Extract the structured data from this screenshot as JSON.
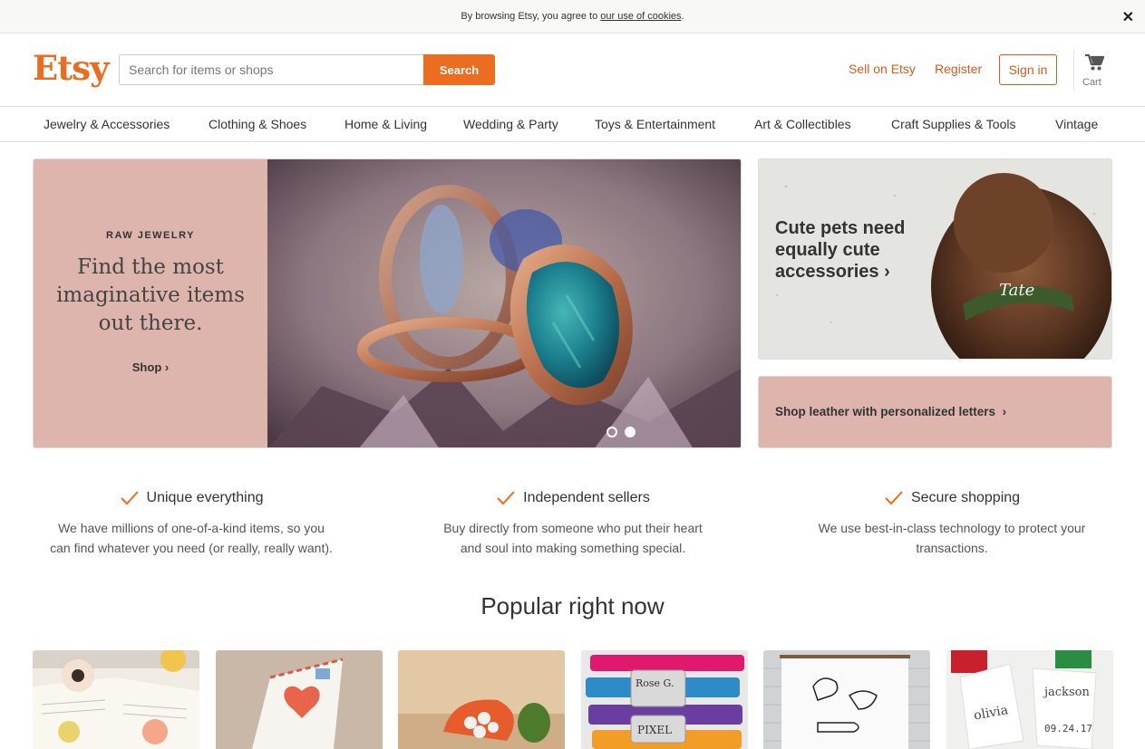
{
  "cookie_bar": {
    "text": "By browsing Etsy, you agree to ",
    "link": "our use of cookies",
    "suffix": "."
  },
  "header": {
    "logo": "Etsy",
    "search_placeholder": "Search for items or shops",
    "search_button": "Search",
    "sell": "Sell on Etsy",
    "register": "Register",
    "signin": "Sign in",
    "cart": "Cart"
  },
  "nav": {
    "items": [
      "Jewelry & Accessories",
      "Clothing & Shoes",
      "Home & Living",
      "Wedding & Party",
      "Toys & Entertainment",
      "Art & Collectibles",
      "Craft Supplies & Tools",
      "Vintage"
    ]
  },
  "hero": {
    "eyebrow": "RAW JEWELRY",
    "headline": "Find the most imaginative items out there.",
    "cta": "Shop",
    "colors": {
      "panel": "#deb5ad"
    }
  },
  "side": {
    "pets_text": "Cute pets need equally cute accessories",
    "collar_text": "Tate",
    "leather_text": "Shop leather with personalized letters"
  },
  "props": [
    {
      "title": "Unique everything",
      "desc": "We have millions of one-of-a-kind items, so you can find whatever you need (or really, really want)."
    },
    {
      "title": "Independent sellers",
      "desc": "Buy directly from someone who put their heart and soul into making something special."
    },
    {
      "title": "Secure shopping",
      "desc": "We use best-in-class technology to protect your transactions."
    }
  ],
  "popular": {
    "title": "Popular right now",
    "item_texts": {
      "collar_name": "Rose G.",
      "collar_brand": "PIXEL",
      "tag1_name": "olivia",
      "tag2_name": "jackson",
      "tag2_date": "09.24.17"
    }
  },
  "colors": {
    "brand": "#eb6d20",
    "link": "#d35b1c",
    "blush": "#deb5ad"
  }
}
